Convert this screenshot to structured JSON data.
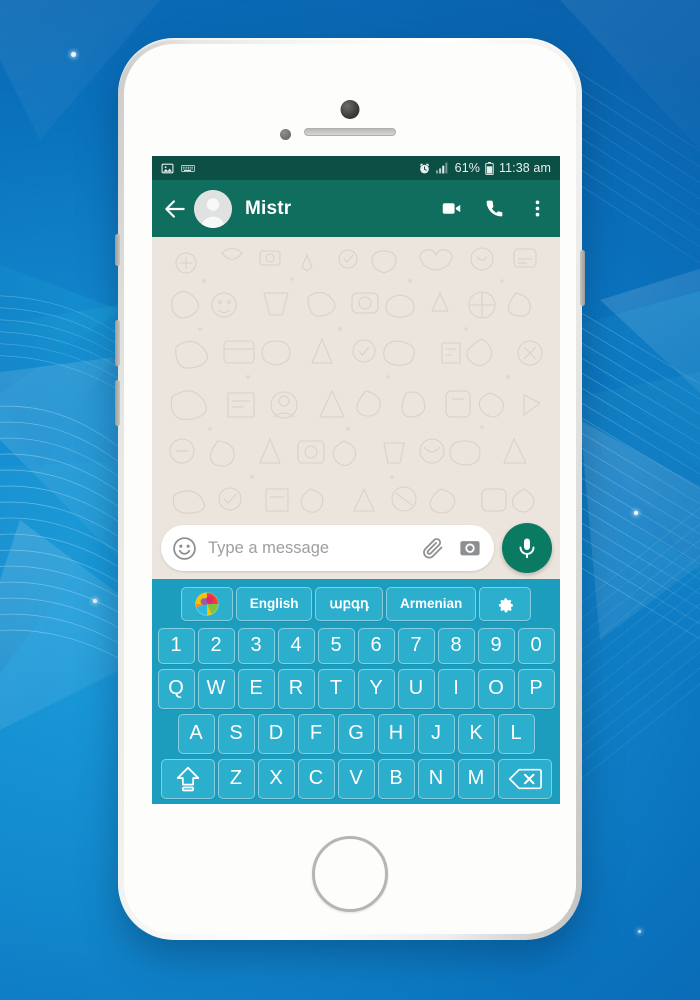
{
  "background": {
    "name": "abstract-blue-geometric",
    "base_color": "#1287cc",
    "accent_color": "#0a62ad"
  },
  "device": {
    "name": "white-smartphone-mockup",
    "frame_color": "#f1f1ef",
    "home_button": "home-button"
  },
  "status_bar": {
    "background": "#0c4f45",
    "left_icons": [
      "image-icon",
      "keyboard-icon"
    ],
    "alarm_icon": "alarm-icon",
    "signal_icon": "signal-bars-icon",
    "battery_percent": "61%",
    "battery_icon": "battery-icon",
    "time": "11:38 am"
  },
  "app_bar": {
    "background": "#0f6e5d",
    "back_icon": "back-arrow-icon",
    "avatar": "contact-avatar",
    "contact_name": "Mistr",
    "actions": [
      {
        "name": "video-call-icon",
        "label": "Video call"
      },
      {
        "name": "voice-call-icon",
        "label": "Voice call"
      },
      {
        "name": "overflow-menu-icon",
        "label": "More options"
      }
    ]
  },
  "chat": {
    "wallpaper": "whatsapp-doodle-pattern",
    "wallpaper_color": "#ece5dd",
    "messages": []
  },
  "input_bar": {
    "emoji_icon": "emoji-icon",
    "placeholder": "Type a message",
    "value": "",
    "attach_icon": "paperclip-icon",
    "camera_icon": "camera-icon",
    "mic_icon": "microphone-icon",
    "mic_button_color": "#0b7a63"
  },
  "keyboard": {
    "theme_color": "#1d9dbd",
    "key_color": "#2caecd",
    "toolbar": [
      {
        "name": "keyboard-logo-button",
        "label": "",
        "icon": "color-sphere-logo-icon"
      },
      {
        "name": "language-english-button",
        "label": "English"
      },
      {
        "name": "language-armenian-native-button",
        "label": "աբգդ"
      },
      {
        "name": "language-armenian-button",
        "label": "Armenian"
      },
      {
        "name": "keyboard-settings-button",
        "label": "",
        "icon": "gear-icon"
      }
    ],
    "row_numbers": [
      "1",
      "2",
      "3",
      "4",
      "5",
      "6",
      "7",
      "8",
      "9",
      "0"
    ],
    "row_top": [
      "Q",
      "W",
      "E",
      "R",
      "T",
      "Y",
      "U",
      "I",
      "O",
      "P"
    ],
    "row_home": [
      "A",
      "S",
      "D",
      "F",
      "G",
      "H",
      "J",
      "K",
      "L"
    ],
    "row_bottom_letters": [
      "Z",
      "X",
      "C",
      "V",
      "B",
      "N",
      "M"
    ],
    "shift_key": {
      "name": "shift-key",
      "icon": "shift-arrow-icon"
    },
    "backspace_key": {
      "name": "backspace-key",
      "icon": "backspace-icon"
    },
    "bottom_row": {
      "symbols_key": {
        "name": "symbols-key",
        "label": "#@"
      },
      "emoji_key": {
        "name": "emoji-key",
        "icon": "smiley-icon"
      },
      "space_key": {
        "name": "space-key",
        "label": ""
      },
      "period_key": {
        "name": "period-key",
        "label": "."
      },
      "enter_key": {
        "name": "enter-key",
        "icon": "enter-arrow-icon"
      }
    }
  }
}
